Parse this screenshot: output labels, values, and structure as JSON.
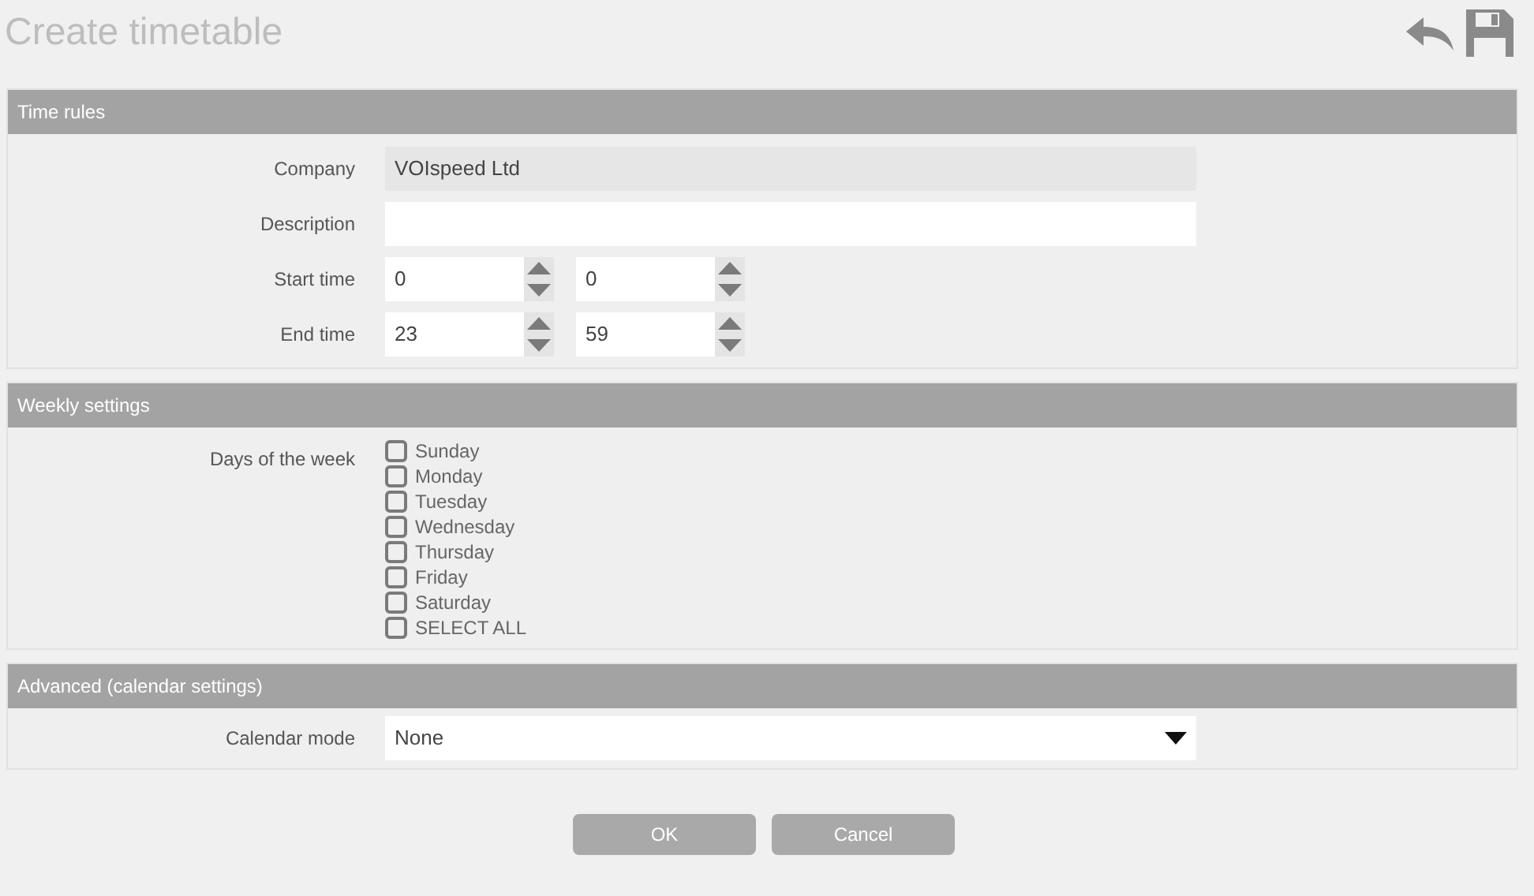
{
  "title": "Create timetable",
  "time_rules": {
    "header": "Time rules",
    "company": {
      "label": "Company",
      "value": "VOIspeed Ltd",
      "disabled": true
    },
    "description": {
      "label": "Description"
    },
    "start_time": {
      "label": "Start time",
      "hours": "0",
      "minutes": "0"
    },
    "end_time": {
      "label": "End time",
      "hours": "23",
      "minutes": "59"
    }
  },
  "weekly_settings": {
    "header": "Weekly settings",
    "label": "Days of the week",
    "days": [
      {
        "label": "Sunday",
        "checked": false
      },
      {
        "label": "Monday",
        "checked": false
      },
      {
        "label": "Tuesday",
        "checked": false
      },
      {
        "label": "Wednesday",
        "checked": false
      },
      {
        "label": "Thursday",
        "checked": false
      },
      {
        "label": "Friday",
        "checked": false
      },
      {
        "label": "Saturday",
        "checked": false
      },
      {
        "label": "SELECT ALL",
        "checked": false
      }
    ]
  },
  "advanced": {
    "header": "Advanced (calendar settings)",
    "calendar_mode": {
      "label": "Calendar mode",
      "value": "None"
    }
  },
  "buttons": [
    "OK",
    "Cancel"
  ]
}
